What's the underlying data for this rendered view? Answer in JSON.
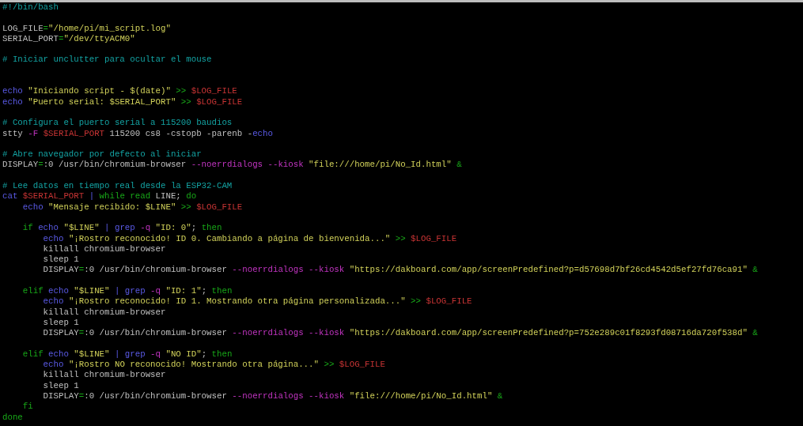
{
  "terminal": {
    "lines": [
      {
        "kind": "code",
        "tokens": [
          {
            "kind": "comment",
            "text": "#!/bin/bash"
          }
        ]
      },
      {
        "kind": "blank"
      },
      {
        "kind": "code",
        "tokens": [
          {
            "kind": "plain",
            "text": "LOG_FILE"
          },
          {
            "kind": "op",
            "text": "="
          },
          {
            "kind": "string",
            "text": "\"/home/pi/mi_script.log\""
          }
        ]
      },
      {
        "kind": "code",
        "tokens": [
          {
            "kind": "plain",
            "text": "SERIAL_PORT"
          },
          {
            "kind": "op",
            "text": "="
          },
          {
            "kind": "string",
            "text": "\"/dev/ttyACM0\""
          }
        ]
      },
      {
        "kind": "blank"
      },
      {
        "kind": "code",
        "tokens": [
          {
            "kind": "comment",
            "text": "# Iniciar unclutter para ocultar el mouse"
          }
        ]
      },
      {
        "kind": "blank"
      },
      {
        "kind": "blank"
      },
      {
        "kind": "code",
        "tokens": [
          {
            "kind": "command",
            "text": "echo "
          },
          {
            "kind": "string",
            "text": "\"Iniciando script - $(date)\" "
          },
          {
            "kind": "op",
            "text": ">> "
          },
          {
            "kind": "variable",
            "text": "$LOG_FILE"
          }
        ]
      },
      {
        "kind": "code",
        "tokens": [
          {
            "kind": "command",
            "text": "echo "
          },
          {
            "kind": "string",
            "text": "\"Puerto serial: $SERIAL_PORT\" "
          },
          {
            "kind": "op",
            "text": ">> "
          },
          {
            "kind": "variable",
            "text": "$LOG_FILE"
          }
        ]
      },
      {
        "kind": "blank"
      },
      {
        "kind": "code",
        "tokens": [
          {
            "kind": "comment",
            "text": "# Configura el puerto serial a 115200 baudios"
          }
        ]
      },
      {
        "kind": "code",
        "tokens": [
          {
            "kind": "plain",
            "text": "stty "
          },
          {
            "kind": "option",
            "text": "-F "
          },
          {
            "kind": "variable",
            "text": "$SERIAL_PORT "
          },
          {
            "kind": "plain",
            "text": "115200 cs8 -cstopb -parenb -"
          },
          {
            "kind": "command",
            "text": "echo"
          }
        ]
      },
      {
        "kind": "blank"
      },
      {
        "kind": "code",
        "tokens": [
          {
            "kind": "comment",
            "text": "# Abre navegador por defecto al iniciar"
          }
        ]
      },
      {
        "kind": "code",
        "tokens": [
          {
            "kind": "plain",
            "text": "DISPLAY"
          },
          {
            "kind": "op",
            "text": "="
          },
          {
            "kind": "plain",
            "text": ":0 /usr/bin/chromium-browser "
          },
          {
            "kind": "option",
            "text": "--noerrdialogs --kiosk "
          },
          {
            "kind": "string",
            "text": "\"file:///home/pi/No_Id.html\" "
          },
          {
            "kind": "op",
            "text": "&"
          }
        ]
      },
      {
        "kind": "blank"
      },
      {
        "kind": "code",
        "tokens": [
          {
            "kind": "comment",
            "text": "# Lee datos en tiempo real desde la ESP32-CAM"
          }
        ]
      },
      {
        "kind": "code",
        "tokens": [
          {
            "kind": "command",
            "text": "cat "
          },
          {
            "kind": "variable",
            "text": "$SERIAL_PORT "
          },
          {
            "kind": "command",
            "text": "| "
          },
          {
            "kind": "keyword",
            "text": "while read "
          },
          {
            "kind": "plain",
            "text": "LINE; "
          },
          {
            "kind": "keyword",
            "text": "do"
          }
        ]
      },
      {
        "kind": "code",
        "tokens": [
          {
            "kind": "command",
            "text": "    echo "
          },
          {
            "kind": "string",
            "text": "\"Mensaje recibido: $LINE\" "
          },
          {
            "kind": "op",
            "text": ">> "
          },
          {
            "kind": "variable",
            "text": "$LOG_FILE"
          }
        ]
      },
      {
        "kind": "blank"
      },
      {
        "kind": "code",
        "tokens": [
          {
            "kind": "keyword",
            "text": "    if "
          },
          {
            "kind": "command",
            "text": "echo "
          },
          {
            "kind": "string",
            "text": "\"$LINE\" "
          },
          {
            "kind": "command",
            "text": "| grep "
          },
          {
            "kind": "option",
            "text": "-q "
          },
          {
            "kind": "string",
            "text": "\"ID: 0\""
          },
          {
            "kind": "plain",
            "text": "; "
          },
          {
            "kind": "keyword",
            "text": "then"
          }
        ]
      },
      {
        "kind": "code",
        "tokens": [
          {
            "kind": "command",
            "text": "        echo "
          },
          {
            "kind": "string",
            "text": "\"¡Rostro reconocido! ID 0. Cambiando a página de bienvenida...\" "
          },
          {
            "kind": "op",
            "text": ">> "
          },
          {
            "kind": "variable",
            "text": "$LOG_FILE"
          }
        ]
      },
      {
        "kind": "code",
        "tokens": [
          {
            "kind": "plain",
            "text": "        killall chromium-browser"
          }
        ]
      },
      {
        "kind": "code",
        "tokens": [
          {
            "kind": "plain",
            "text": "        sleep 1"
          }
        ]
      },
      {
        "kind": "code",
        "tokens": [
          {
            "kind": "plain",
            "text": "        DISPLAY"
          },
          {
            "kind": "op",
            "text": "="
          },
          {
            "kind": "plain",
            "text": ":0 /usr/bin/chromium-browser "
          },
          {
            "kind": "option",
            "text": "--noerrdialogs --kiosk "
          },
          {
            "kind": "string",
            "text": "\"https://dakboard.com/app/screenPredefined?p=d57698d7bf26cd4542d5ef27fd76ca91\" "
          },
          {
            "kind": "op",
            "text": "&"
          }
        ]
      },
      {
        "kind": "blank"
      },
      {
        "kind": "code",
        "tokens": [
          {
            "kind": "keyword",
            "text": "    elif "
          },
          {
            "kind": "command",
            "text": "echo "
          },
          {
            "kind": "string",
            "text": "\"$LINE\" "
          },
          {
            "kind": "command",
            "text": "| grep "
          },
          {
            "kind": "option",
            "text": "-q "
          },
          {
            "kind": "string",
            "text": "\"ID: 1\""
          },
          {
            "kind": "plain",
            "text": "; "
          },
          {
            "kind": "keyword",
            "text": "then"
          }
        ]
      },
      {
        "kind": "code",
        "tokens": [
          {
            "kind": "command",
            "text": "        echo "
          },
          {
            "kind": "string",
            "text": "\"¡Rostro reconocido! ID 1. Mostrando otra página personalizada...\" "
          },
          {
            "kind": "op",
            "text": ">> "
          },
          {
            "kind": "variable",
            "text": "$LOG_FILE"
          }
        ]
      },
      {
        "kind": "code",
        "tokens": [
          {
            "kind": "plain",
            "text": "        killall chromium-browser"
          }
        ]
      },
      {
        "kind": "code",
        "tokens": [
          {
            "kind": "plain",
            "text": "        sleep 1"
          }
        ]
      },
      {
        "kind": "code",
        "tokens": [
          {
            "kind": "plain",
            "text": "        DISPLAY"
          },
          {
            "kind": "op",
            "text": "="
          },
          {
            "kind": "plain",
            "text": ":0 /usr/bin/chromium-browser "
          },
          {
            "kind": "option",
            "text": "--noerrdialogs --kiosk "
          },
          {
            "kind": "string",
            "text": "\"https://dakboard.com/app/screenPredefined?p=752e289c01f8293fd08716da720f538d\" "
          },
          {
            "kind": "op",
            "text": "&"
          }
        ]
      },
      {
        "kind": "blank"
      },
      {
        "kind": "code",
        "tokens": [
          {
            "kind": "keyword",
            "text": "    elif "
          },
          {
            "kind": "command",
            "text": "echo "
          },
          {
            "kind": "string",
            "text": "\"$LINE\" "
          },
          {
            "kind": "command",
            "text": "| grep "
          },
          {
            "kind": "option",
            "text": "-q "
          },
          {
            "kind": "string",
            "text": "\"NO ID\""
          },
          {
            "kind": "plain",
            "text": "; "
          },
          {
            "kind": "keyword",
            "text": "then"
          }
        ]
      },
      {
        "kind": "code",
        "tokens": [
          {
            "kind": "command",
            "text": "        echo "
          },
          {
            "kind": "string",
            "text": "\"¡Rostro NO reconocido! Mostrando otra página...\" "
          },
          {
            "kind": "op",
            "text": ">> "
          },
          {
            "kind": "variable",
            "text": "$LOG_FILE"
          }
        ]
      },
      {
        "kind": "code",
        "tokens": [
          {
            "kind": "plain",
            "text": "        killall chromium-browser"
          }
        ]
      },
      {
        "kind": "code",
        "tokens": [
          {
            "kind": "plain",
            "text": "        sleep 1"
          }
        ]
      },
      {
        "kind": "code",
        "tokens": [
          {
            "kind": "plain",
            "text": "        DISPLAY"
          },
          {
            "kind": "op",
            "text": "="
          },
          {
            "kind": "plain",
            "text": ":0 /usr/bin/chromium-browser "
          },
          {
            "kind": "option",
            "text": "--noerrdialogs --kiosk "
          },
          {
            "kind": "string",
            "text": "\"file:///home/pi/No_Id.html\" "
          },
          {
            "kind": "op",
            "text": "&"
          }
        ]
      },
      {
        "kind": "code",
        "tokens": [
          {
            "kind": "keyword",
            "text": "    fi"
          }
        ]
      },
      {
        "kind": "code",
        "tokens": [
          {
            "kind": "keyword",
            "text": "done"
          }
        ]
      }
    ]
  }
}
